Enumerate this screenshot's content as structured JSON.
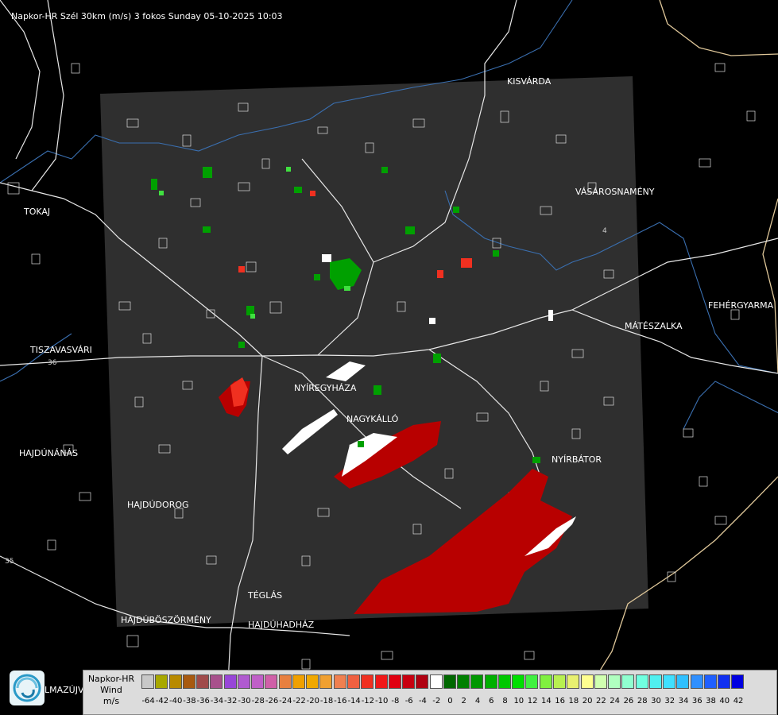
{
  "header": {
    "title": "Napkor-HR Szél 30km (m/s) 3 fokos Sunday 05-10-2025 10:03"
  },
  "towns": [
    {
      "id": "kisvarda",
      "name": "KISVÁRDA"
    },
    {
      "id": "tokaj",
      "name": "TOKAJ"
    },
    {
      "id": "vasarosnameny",
      "name": "VÁSÁROSNAMÉNY"
    },
    {
      "id": "fehergyarmat",
      "name": "FEHÉRGYARMA"
    },
    {
      "id": "mateszalka",
      "name": "MÁTÉSZALKA"
    },
    {
      "id": "tiszavasvari",
      "name": "TISZAVASVÁRI"
    },
    {
      "id": "nyiregyhaza",
      "name": "NYÍREGYHÁZA"
    },
    {
      "id": "nagykallo",
      "name": "NAGYKÁLLÓ"
    },
    {
      "id": "hajdunanas",
      "name": "HAJDÚNÁNÁS"
    },
    {
      "id": "nyirbator",
      "name": "NYÍRBÁTOR"
    },
    {
      "id": "hajdudorog",
      "name": "HAJDÚDOROG"
    },
    {
      "id": "teglas",
      "name": "TÉGLÁS"
    },
    {
      "id": "hajduboszormeny",
      "name": "HAJDÚBÖSZÖRMÉNY"
    },
    {
      "id": "hajduhadhaz",
      "name": "HAJDÚHADHÁZ"
    }
  ],
  "road_numbers": [
    "36",
    "4",
    "35"
  ],
  "logo": {
    "text": "LMAZÚJVÁR"
  },
  "legend": {
    "caption_line1": "Napkor-HR",
    "caption_line2": "Wind",
    "caption_line3": "m/s",
    "ticks": [
      "-64",
      "-42",
      "-40",
      "-38",
      "-36",
      "-34",
      "-32",
      "-30",
      "-28",
      "-26",
      "-24",
      "-22",
      "-20",
      "-18",
      "-16",
      "-14",
      "-12",
      "-10",
      "-8",
      "-6",
      "-4",
      "-2",
      "0",
      "2",
      "4",
      "6",
      "8",
      "10",
      "12",
      "14",
      "16",
      "18",
      "20",
      "22",
      "24",
      "26",
      "28",
      "30",
      "32",
      "34",
      "36",
      "38",
      "40",
      "42"
    ],
    "colors": [
      "#c8c8c8",
      "#a8a800",
      "#b88a00",
      "#a85a10",
      "#a04a4a",
      "#a8508c",
      "#9846d8",
      "#b05ad0",
      "#c060c8",
      "#d060a8",
      "#e88040",
      "#f0a000",
      "#f0a800",
      "#f0a030",
      "#f08050",
      "#f06040",
      "#f03020",
      "#f01818",
      "#e00010",
      "#c80010",
      "#b00010",
      "#ffffff",
      "#006800",
      "#008000",
      "#009800",
      "#00b000",
      "#00c800",
      "#00e000",
      "#40f040",
      "#80f040",
      "#b8f050",
      "#e8f070",
      "#ffff90",
      "#d0ffb0",
      "#b0ffc0",
      "#90ffd0",
      "#70ffe0",
      "#50f0f0",
      "#40e0ff",
      "#30c0ff",
      "#3090ff",
      "#2060ff",
      "#1030f0",
      "#0000e0"
    ]
  }
}
